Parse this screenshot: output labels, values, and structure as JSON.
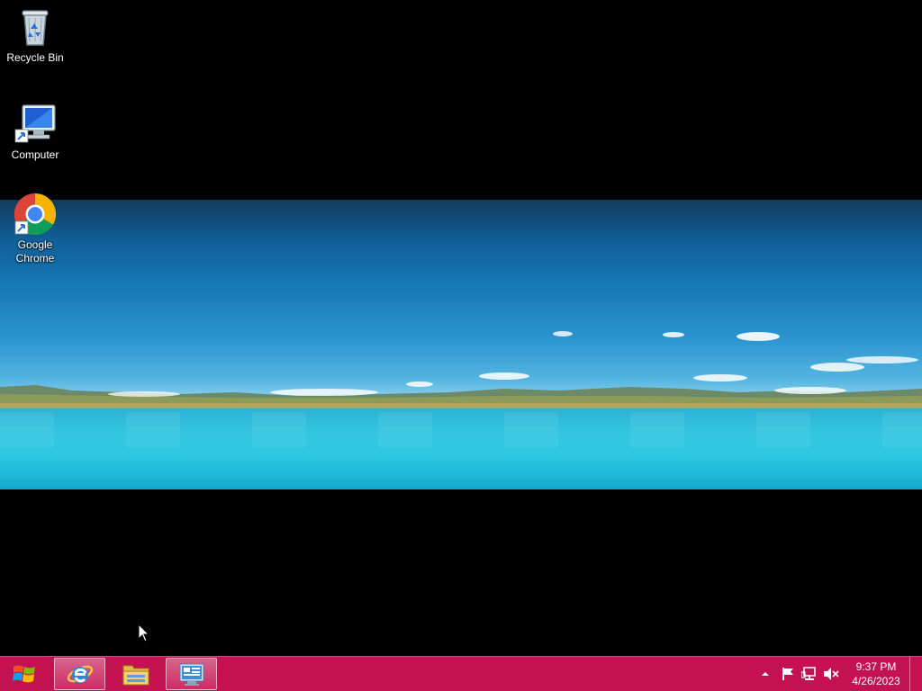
{
  "desktop": {
    "icons": [
      {
        "label": "Recycle Bin",
        "icon": "recycle-bin-icon"
      },
      {
        "label": "Computer",
        "icon": "computer-icon"
      },
      {
        "label": "Google Chrome",
        "icon": "chrome-icon"
      }
    ]
  },
  "taskbar": {
    "color": "#c3124f",
    "start_icon": "windows-logo-icon",
    "pinned": [
      {
        "icon": "internet-explorer-icon"
      },
      {
        "icon": "file-explorer-icon"
      },
      {
        "icon": "control-panel-icon"
      }
    ],
    "tray": {
      "icons": [
        "show-hidden-icons-chevron-icon",
        "action-center-flag-icon",
        "network-icon",
        "volume-muted-icon"
      ]
    },
    "clock": {
      "time": "9:37 PM",
      "date": "4/26/2023"
    }
  }
}
